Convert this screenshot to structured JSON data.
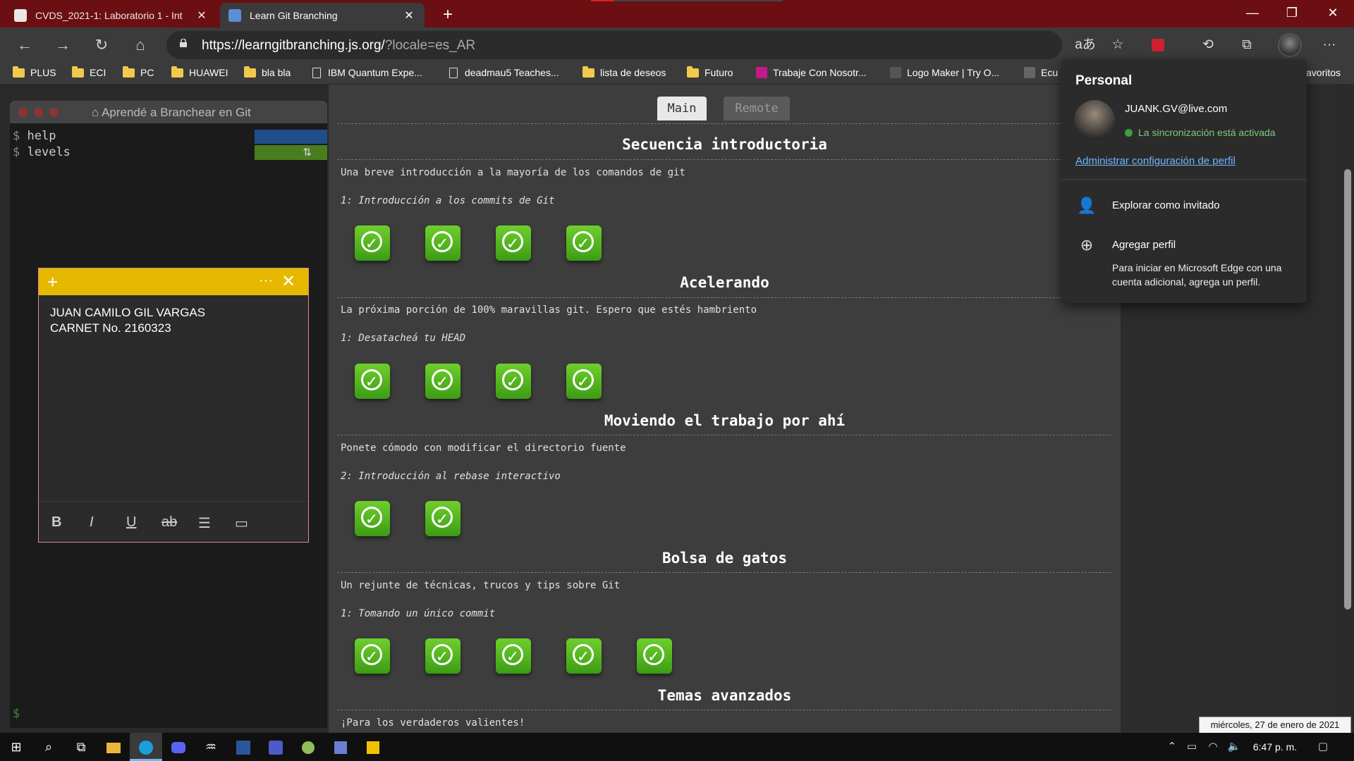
{
  "tabs": [
    {
      "title": "CVDS_2021-1: Laboratorio 1 - Int",
      "active": false,
      "favicon_color": "#e8e8e8"
    },
    {
      "title": "Learn Git Branching",
      "active": true,
      "favicon_color": "#5a8fd6"
    }
  ],
  "toolbar": {
    "url_host": "https://learngitbranching.js.org/",
    "url_query": "?locale=es_AR"
  },
  "favorites": [
    {
      "label": "PLUS",
      "kind": "folder"
    },
    {
      "label": "ECI",
      "kind": "folder"
    },
    {
      "label": "PC",
      "kind": "folder"
    },
    {
      "label": "HUAWEI",
      "kind": "folder"
    },
    {
      "label": "bla bla",
      "kind": "folder"
    },
    {
      "label": "IBM Quantum Expe...",
      "kind": "doc"
    },
    {
      "label": "deadmau5 Teaches...",
      "kind": "doc"
    },
    {
      "label": "lista de deseos",
      "kind": "folder"
    },
    {
      "label": "Futuro",
      "kind": "folder"
    },
    {
      "label": "Trabaje Con Nosotr...",
      "kind": "site"
    },
    {
      "label": "Logo Maker | Try O...",
      "kind": "site"
    },
    {
      "label": "Ecu",
      "kind": "site"
    },
    {
      "label": "avoritos",
      "kind": "text"
    }
  ],
  "terminal": {
    "title": "Aprendé a Branchear en Git",
    "lines": [
      "help",
      "levels"
    ],
    "prompt": "$",
    "green_bar_icon": "⇅"
  },
  "main_tabs": {
    "main": "Main",
    "remote": "Remote"
  },
  "sections": [
    {
      "title": "Secuencia introductoria",
      "desc": "Una breve introducción a la mayoría de los comandos de git",
      "sub": "1: Introducción a los commits de Git",
      "levels": 4
    },
    {
      "title": "Acelerando",
      "desc": "La próxima porción de 100% maravillas git. Espero que estés hambriento",
      "sub": "1: Desatacheá tu HEAD",
      "levels": 4
    },
    {
      "title": "Moviendo el trabajo por ahí",
      "desc": "Ponete cómodo con modificar el directorio fuente",
      "sub": "2: Introducción al rebase interactivo",
      "levels": 2
    },
    {
      "title": "Bolsa de gatos",
      "desc": "Un rejunte de técnicas, trucos y tips sobre Git",
      "sub": "1: Tomando un único commit",
      "levels": 5
    },
    {
      "title": "Temas avanzados",
      "desc": "¡Para los verdaderos valientes!",
      "sub": "",
      "levels": 0
    }
  ],
  "sticky_note": {
    "line1": "JUAN CAMILO GIL VARGAS",
    "line2": "CARNET No. 2160323",
    "header_color": "#e6b800"
  },
  "profile": {
    "heading": "Personal",
    "email": "JUANK.GV@live.com",
    "sync": "La sincronización está activada",
    "manage": "Administrar configuración de perfil",
    "guest": "Explorar como invitado",
    "add": "Agregar perfil",
    "add_note": "Para iniciar en Microsoft Edge con una cuenta adicional, agrega un perfil."
  },
  "tooltip": "miércoles, 27 de enero de 2021",
  "clock": "6:47 p. m."
}
